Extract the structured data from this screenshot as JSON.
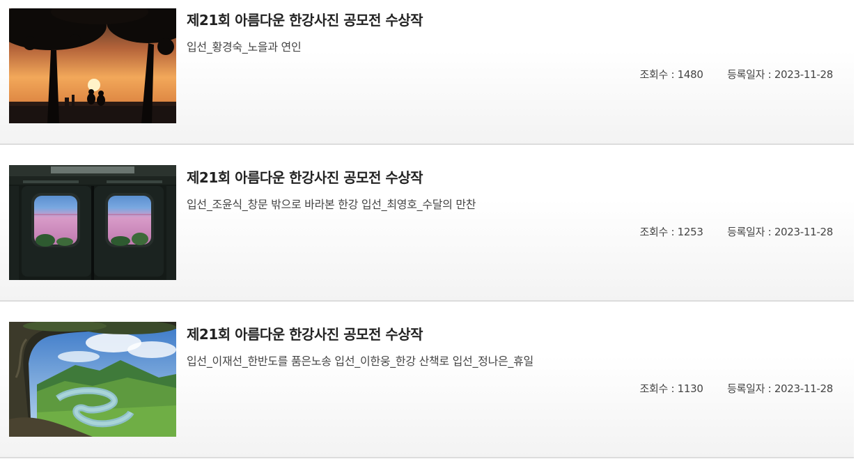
{
  "labels": {
    "views_prefix": "조회수 : ",
    "date_prefix": "등록일자 : "
  },
  "items": [
    {
      "title": "제21회 아름다운 한강사진 공모전 수상작",
      "subtitle": "입선_황경숙_노을과 연인",
      "views": "조회수 : 1480",
      "date": "등록일자 : 2023-11-28",
      "thumbnail": "sunset-couple-under-trees"
    },
    {
      "title": "제21회 아름다운 한강사진 공모전 수상작",
      "subtitle": "입선_조윤식_창문 밖으로 바라본 한강 입선_최영호_수달의 만찬",
      "views": "조회수 : 1253",
      "date": "등록일자 : 2023-11-28",
      "thumbnail": "subway-door-windows-pink-sky"
    },
    {
      "title": "제21회 아름다운 한강사진 공모전 수상작",
      "subtitle": "입선_이재선_한반도를 품은노송 입선_이한웅_한강 산책로 입선_정나은_휴일",
      "views": "조회수 : 1130",
      "date": "등록일자 : 2023-11-28",
      "thumbnail": "river-bend-mountains-through-pine"
    }
  ]
}
